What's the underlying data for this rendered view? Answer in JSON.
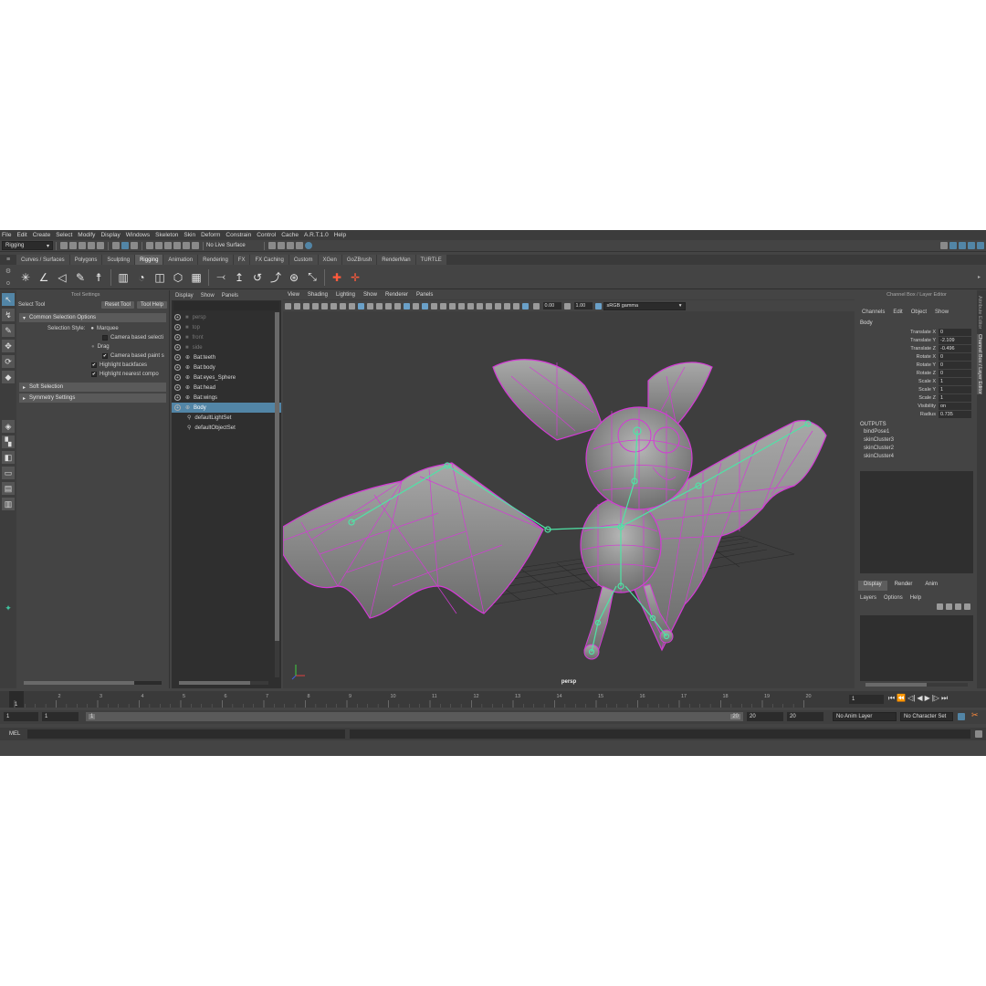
{
  "menubar": [
    "File",
    "Edit",
    "Create",
    "Select",
    "Modify",
    "Display",
    "Windows",
    "Skeleton",
    "Skin",
    "Deform",
    "Constrain",
    "Control",
    "Cache",
    "A.R.T.1.0",
    "Help"
  ],
  "statusline": {
    "mode": "Rigging",
    "live_surface": "No Live Surface"
  },
  "shelf_tabs": [
    {
      "label": "Curves / Surfaces",
      "active": false
    },
    {
      "label": "Polygons",
      "active": false
    },
    {
      "label": "Sculpting",
      "active": false
    },
    {
      "label": "Rigging",
      "active": true
    },
    {
      "label": "Animation",
      "active": false
    },
    {
      "label": "Rendering",
      "active": false
    },
    {
      "label": "FX",
      "active": false
    },
    {
      "label": "FX Caching",
      "active": false
    },
    {
      "label": "Custom",
      "active": false
    },
    {
      "label": "XGen",
      "active": false
    },
    {
      "label": "GoZBrush",
      "active": false
    },
    {
      "label": "RenderMan",
      "active": false
    },
    {
      "label": "TURTLE",
      "active": false
    }
  ],
  "tool_settings": {
    "panel_title": "Tool Settings",
    "tool_name": "Select Tool",
    "reset_label": "Reset Tool",
    "help_label": "Tool Help",
    "section_common": "Common Selection Options",
    "selection_style_label": "Selection Style:",
    "marquee": "Marquee",
    "camera_based_selection": "Camera based selecti",
    "drag": "Drag",
    "camera_based_paint": "Camera based paint s",
    "highlight_backfaces": "Highlight backfaces",
    "highlight_nearest": "Highlight nearest compo",
    "section_soft": "Soft Selection",
    "section_symmetry": "Symmetry Settings"
  },
  "outliner": {
    "menu": [
      "Display",
      "Show",
      "Panels"
    ],
    "items": [
      {
        "label": "persp",
        "dim": true,
        "selected": false
      },
      {
        "label": "top",
        "dim": true,
        "selected": false
      },
      {
        "label": "front",
        "dim": true,
        "selected": false
      },
      {
        "label": "side",
        "dim": true,
        "selected": false
      },
      {
        "label": "Bat:teeth",
        "dim": false,
        "selected": false
      },
      {
        "label": "Bat:body",
        "dim": false,
        "selected": false
      },
      {
        "label": "Bat:eyes_Sphere",
        "dim": false,
        "selected": false
      },
      {
        "label": "Bat:head",
        "dim": false,
        "selected": false
      },
      {
        "label": "Bat:wings",
        "dim": false,
        "selected": false
      },
      {
        "label": "Body",
        "dim": false,
        "selected": true
      },
      {
        "label": "defaultLightSet",
        "dim": false,
        "selected": false
      },
      {
        "label": "defaultObjectSet",
        "dim": false,
        "selected": false
      }
    ]
  },
  "viewport": {
    "menu": [
      "View",
      "Shading",
      "Lighting",
      "Show",
      "Renderer",
      "Panels"
    ],
    "exposure": "0.00",
    "gamma": "1.00",
    "color_space": "sRGB gamma",
    "camera_label": "persp"
  },
  "channel_box": {
    "panel_title": "Channel Box / Layer Editor",
    "menu": [
      "Channels",
      "Edit",
      "Object",
      "Show"
    ],
    "object_name": "Body",
    "channels": [
      {
        "label": "Translate X",
        "value": "0"
      },
      {
        "label": "Translate Y",
        "value": "-2.109"
      },
      {
        "label": "Translate Z",
        "value": "-0.496"
      },
      {
        "label": "Rotate X",
        "value": "0"
      },
      {
        "label": "Rotate Y",
        "value": "0"
      },
      {
        "label": "Rotate Z",
        "value": "0"
      },
      {
        "label": "Scale X",
        "value": "1"
      },
      {
        "label": "Scale Y",
        "value": "1"
      },
      {
        "label": "Scale Z",
        "value": "1"
      },
      {
        "label": "Visibility",
        "value": "on"
      },
      {
        "label": "Radius",
        "value": "0.735"
      }
    ],
    "outputs_label": "OUTPUTS",
    "outputs": [
      "bindPose1",
      "skinCluster3",
      "skinCluster2",
      "skinCluster4"
    ],
    "layer_tabs": [
      "Display",
      "Render",
      "Anim"
    ],
    "layer_menu": [
      "Layers",
      "Options",
      "Help"
    ],
    "side_tabs": [
      "Attribute Editor",
      "Channel Box / Layer Editor"
    ]
  },
  "timeline": {
    "ticks": [
      "1",
      "2",
      "3",
      "4",
      "5",
      "6",
      "7",
      "8",
      "9",
      "10",
      "11",
      "12",
      "13",
      "14",
      "15",
      "16",
      "17",
      "18",
      "19",
      "20"
    ],
    "current_frame": "1",
    "current_frame_field": "1"
  },
  "range": {
    "start": "1",
    "start_inner": "1",
    "range_start_label": "1",
    "range_end_label": "20",
    "end": "20",
    "end_outer": "20",
    "anim_layer": "No Anim Layer",
    "character_set": "No Character Set"
  },
  "command_line": {
    "label": "MEL"
  },
  "colors": {
    "wire": "#d43ad6",
    "joint": "#4fe3a6",
    "selection": "#5285a6",
    "mesh": "#9a9a9a"
  }
}
